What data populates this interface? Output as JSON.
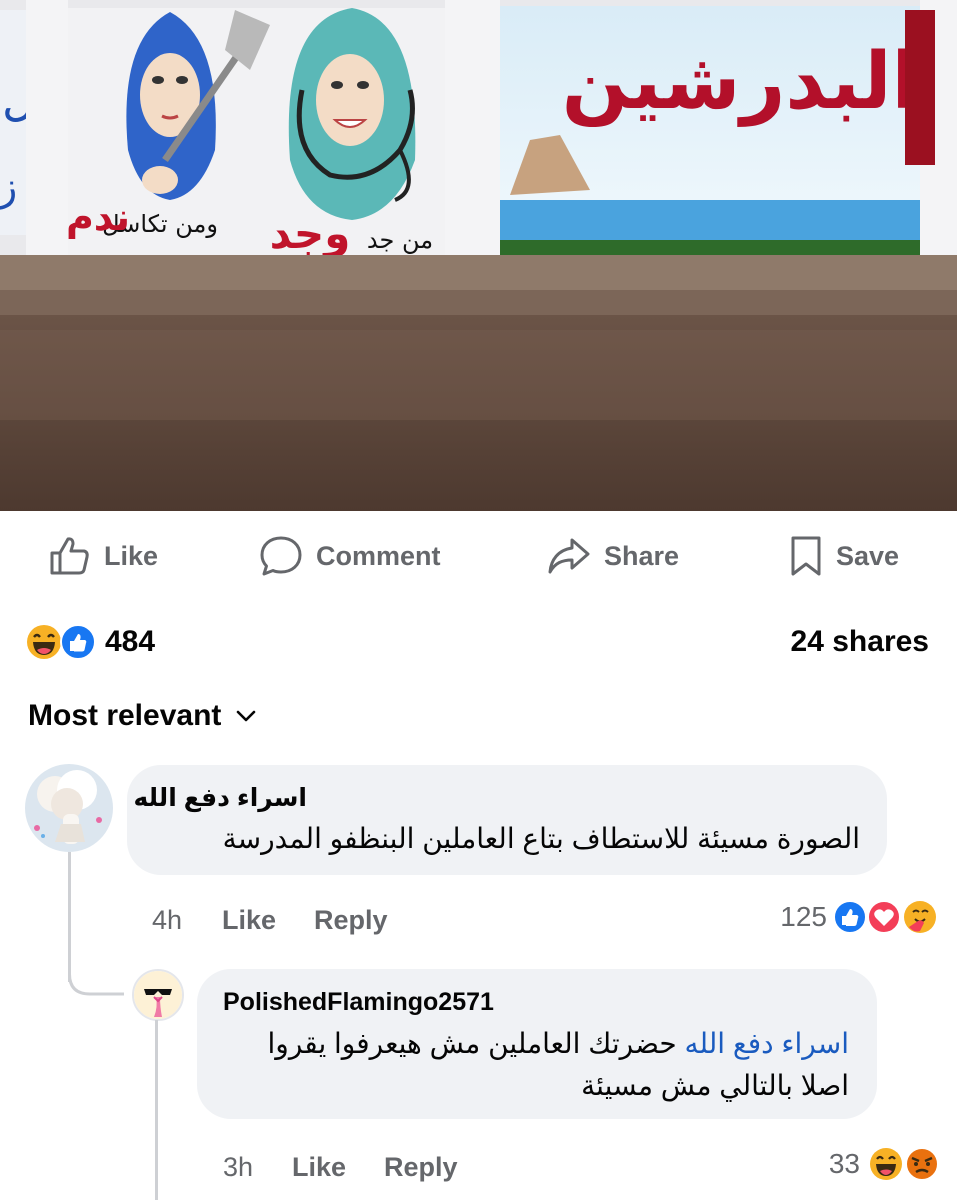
{
  "post": {
    "image": {
      "mural_title": "البدرشين",
      "slogan_left_small": "ومن تكاسل",
      "slogan_left_big": "ندم",
      "slogan_right_small": "من جد",
      "slogan_right_big": "وجد"
    },
    "actions": {
      "like_label": "Like",
      "comment_label": "Comment",
      "share_label": "Share",
      "save_label": "Save"
    },
    "reactions": {
      "count": "484",
      "icons": [
        "laugh-icon",
        "like-icon"
      ]
    },
    "shares_label": "24 shares"
  },
  "comments_sort": {
    "label": "Most relevant"
  },
  "comments": [
    {
      "author": "اسراء دفع الله",
      "text": "الصورة مسيئة للاستطاف بتاع العاملين  البنظفو  المدرسة",
      "time": "4h",
      "like_label": "Like",
      "reply_label": "Reply",
      "reaction_count": "125",
      "reaction_icons": [
        "like-icon",
        "love-icon",
        "care-icon"
      ],
      "replies": [
        {
          "author": "PolishedFlamingo2571",
          "mention": "اسراء دفع الله",
          "text_line1": "حضرتك العاملين مش هيعرفوا يقروا",
          "text_line2": "اصلا بالتالي مش مسيئة",
          "time": "3h",
          "like_label": "Like",
          "reply_label": "Reply",
          "reaction_count": "33",
          "reaction_icons": [
            "laugh-icon",
            "angry-icon"
          ]
        }
      ]
    }
  ],
  "colors": {
    "like_blue": "#1877f2",
    "love_red": "#f33e58",
    "emoji_yellow": "#f7b125",
    "angry_orange": "#e9710f",
    "secondary_text": "#65676b",
    "bubble_bg": "#f0f2f5",
    "mention_blue": "#1a5bbf"
  }
}
